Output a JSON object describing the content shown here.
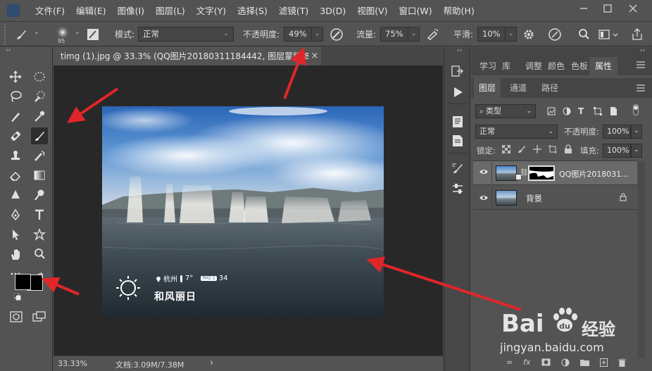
{
  "menubar": {
    "items": [
      "文件(F)",
      "编辑(E)",
      "图像(I)",
      "图层(L)",
      "文字(Y)",
      "选择(S)",
      "滤镜(T)",
      "3D(D)",
      "视图(V)",
      "窗口(W)",
      "帮助(H)"
    ]
  },
  "optionsbar": {
    "brush_size": "95",
    "mode_label": "模式:",
    "mode_value": "正常",
    "opacity_label": "不透明度:",
    "opacity_value": "49%",
    "flow_label": "流量:",
    "flow_value": "75%",
    "smooth_label": "平滑:",
    "smooth_value": "10%"
  },
  "document": {
    "tab_title": "timg (1).jpg @ 33.3% (QQ图片20180311184442, 图层蒙版/8)",
    "close_symbol": "×",
    "zoom": "33.33%",
    "doc_info": "文档:3.09M/7.38M",
    "status_arrow": "›"
  },
  "image_overlay": {
    "location": "杭州",
    "temperature": "7°",
    "aqi_badge": "PM2.5",
    "aqi_value": "34",
    "weather": "和风丽日"
  },
  "panels": {
    "top_tabs": [
      "学习",
      "库",
      "调整",
      "颜色",
      "色板",
      "属性"
    ],
    "active_top_tab": "属性",
    "layer_tabs": [
      "图层",
      "通道",
      "路径"
    ],
    "filter_label": "类型",
    "blend_mode": "正常",
    "opacity_label": "不透明度:",
    "opacity_value": "100%",
    "lock_label": "锁定:",
    "fill_label": "填充:",
    "fill_value": "100%",
    "layers": [
      {
        "name": "QQ图片2018031...",
        "selected": true
      },
      {
        "name": "背景",
        "selected": false
      }
    ]
  },
  "watermark": {
    "brand": "Bai",
    "brand_tail": "经验",
    "url": "jingyan.baidu.com"
  },
  "colors": {
    "accent_arrow": "#e0262a",
    "panel_bg": "#535353",
    "canvas_bg": "#282828",
    "selected_layer": "#6a6a6a"
  }
}
